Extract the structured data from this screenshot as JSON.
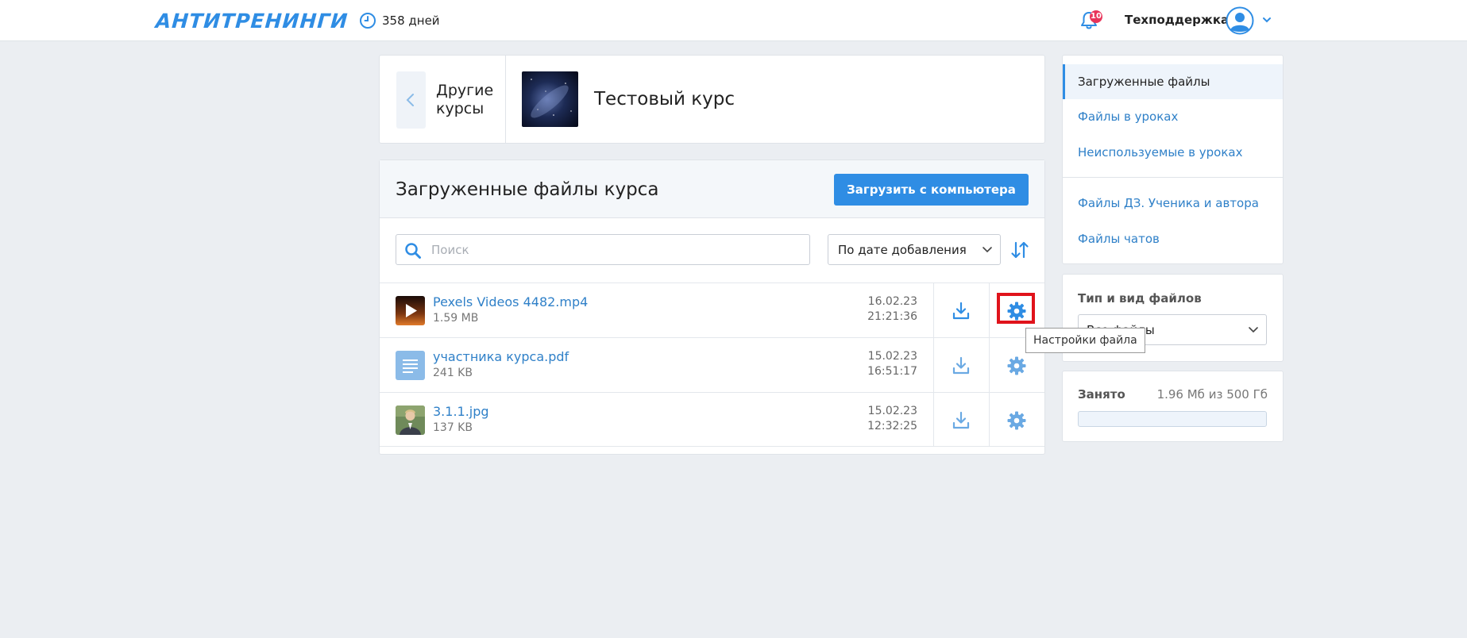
{
  "header": {
    "logo": "АНТИТРЕНИНГИ",
    "days": "358 дней",
    "notifications_count": "10",
    "user_name": "Техподдержка"
  },
  "course": {
    "back_label": "Другие курсы",
    "title": "Тестовый курс"
  },
  "files": {
    "title": "Загруженные файлы курса",
    "upload_button": "Загрузить с компьютера",
    "search_placeholder": "Поиск",
    "sort_selected": "По дате добавления",
    "items": [
      {
        "name": "Pexels Videos 4482.mp4",
        "size": "1.59 MB",
        "date": "16.02.23",
        "time": "21:21:36",
        "type": "video"
      },
      {
        "name": "участника курса.pdf",
        "size": "241 KB",
        "date": "15.02.23",
        "time": "16:51:17",
        "type": "document"
      },
      {
        "name": "3.1.1.jpg",
        "size": "137 KB",
        "date": "15.02.23",
        "time": "12:32:25",
        "type": "image"
      }
    ],
    "tooltip": "Настройки файла"
  },
  "sidebar": {
    "items": [
      {
        "label": "Загруженные файлы",
        "active": true
      },
      {
        "label": "Файлы в уроках",
        "active": false
      },
      {
        "label": "Неиспользуемые в уроках",
        "active": false
      },
      {
        "label": "Файлы ДЗ. Ученика и автора",
        "active": false
      },
      {
        "label": "Файлы чатов",
        "active": false
      }
    ],
    "type_label": "Тип и вид файлов",
    "type_selected": "Все файлы",
    "usage_label": "Занято",
    "usage_value": "1.96 Мб из 500 Гб",
    "usage_fraction": 4e-06
  },
  "colors": {
    "accent": "#2f8de4",
    "link": "#2f80c8",
    "highlight": "#e0131b",
    "background": "#ebeef2"
  }
}
